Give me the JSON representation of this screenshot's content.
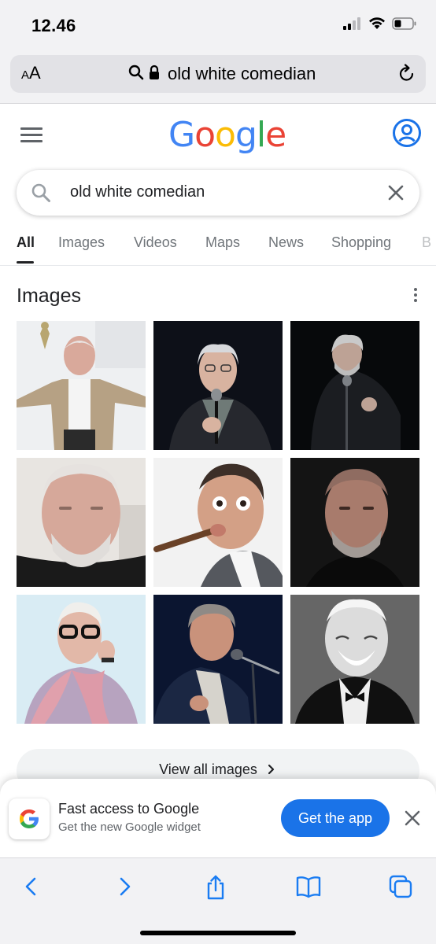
{
  "status": {
    "time": "12.46",
    "icons": [
      "cellular-signal-icon",
      "wifi-icon",
      "battery-icon"
    ]
  },
  "browser": {
    "text_size_label_small": "A",
    "text_size_label_large": "A",
    "url": "old white comedian",
    "icons": [
      "search-icon",
      "lock-icon",
      "reload-icon"
    ]
  },
  "google": {
    "logo_letters": [
      "G",
      "o",
      "o",
      "g",
      "l",
      "e"
    ],
    "logo_colors": [
      "#4285F4",
      "#EA4335",
      "#FBBC05",
      "#4285F4",
      "#34A853",
      "#EA4335"
    ],
    "search_query": "old white comedian"
  },
  "tabs": [
    {
      "label": "All",
      "active": true
    },
    {
      "label": "Images",
      "active": false
    },
    {
      "label": "Videos",
      "active": false
    },
    {
      "label": "Maps",
      "active": false
    },
    {
      "label": "News",
      "active": false
    },
    {
      "label": "Shopping",
      "active": false
    },
    {
      "label": "B",
      "active": false
    }
  ],
  "images_section": {
    "title": "Images",
    "view_all_label": "View all images",
    "thumbnails": [
      "comedian-photo-1",
      "comedian-photo-2",
      "comedian-photo-3",
      "comedian-photo-4",
      "comedian-photo-5",
      "comedian-photo-6",
      "comedian-photo-7",
      "comedian-photo-8",
      "comedian-photo-9"
    ]
  },
  "promo": {
    "title": "Fast access to Google",
    "subtitle": "Get the new Google widget",
    "cta": "Get the app",
    "badge_letter": "G"
  },
  "toolbar": {
    "icons": [
      "back-icon",
      "forward-icon",
      "share-icon",
      "bookmarks-icon",
      "tabs-icon"
    ]
  },
  "colors": {
    "accent": "#1a73e8",
    "chrome_bg": "#f2f2f4",
    "text_primary": "#202124",
    "text_secondary": "#70757a"
  }
}
